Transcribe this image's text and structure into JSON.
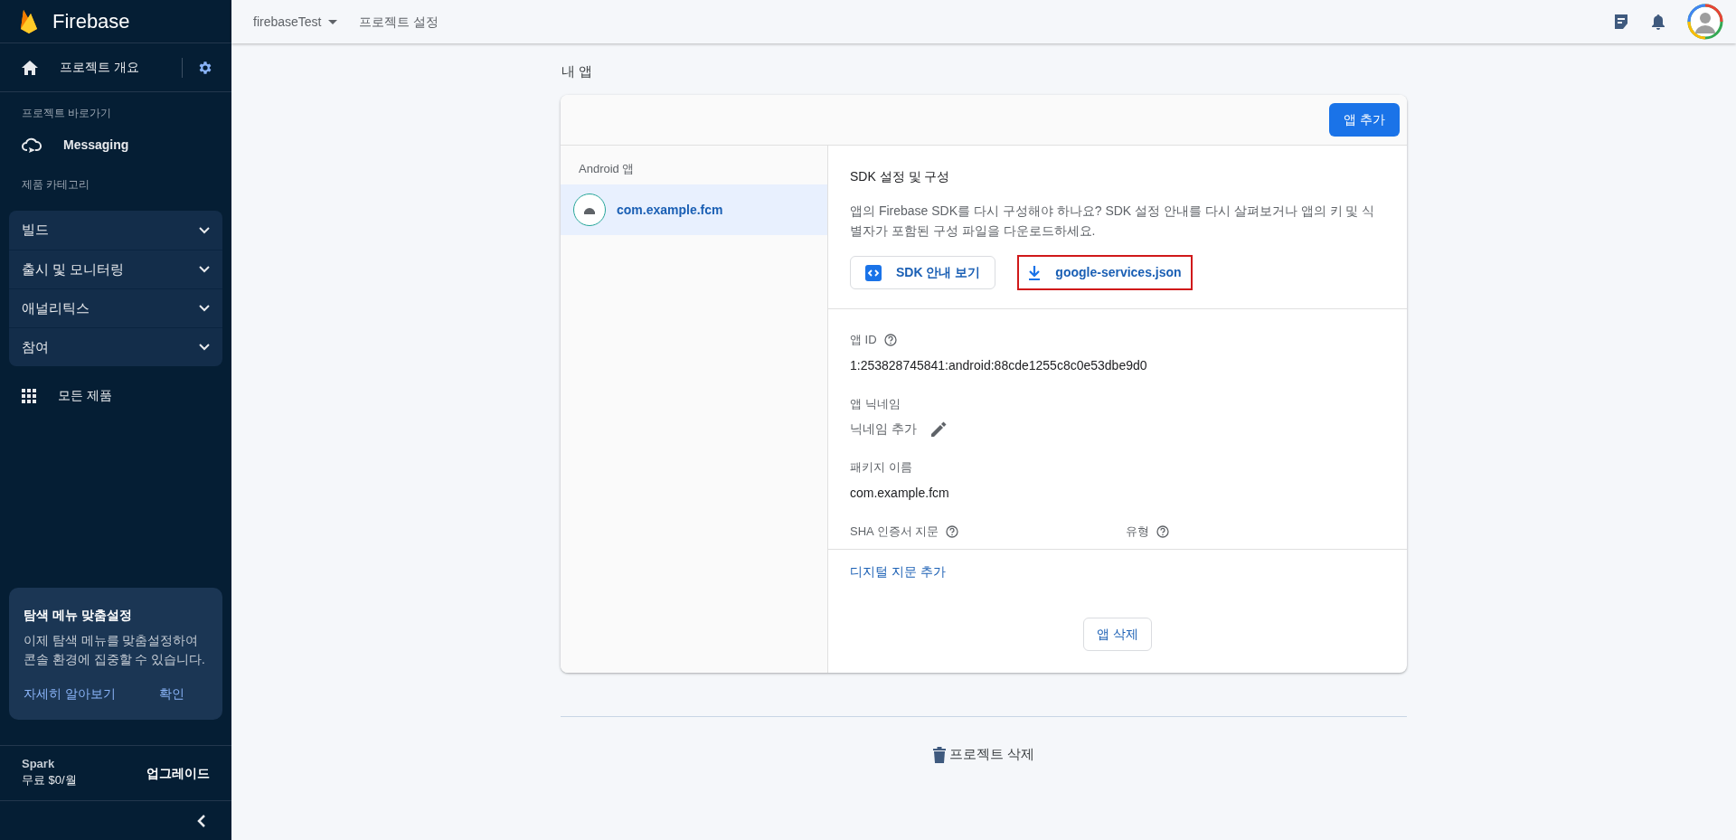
{
  "sidebar": {
    "brand": "Firebase",
    "overview": "프로젝트 개요",
    "shortcuts_heading": "프로젝트 바로가기",
    "shortcuts": [
      {
        "label": "Messaging"
      }
    ],
    "categories_heading": "제품 카테고리",
    "categories": [
      {
        "label": "빌드",
        "expanded": false
      },
      {
        "label": "출시 및 모니터링",
        "expanded": false
      },
      {
        "label": "애널리틱스",
        "expanded": false
      },
      {
        "label": "참여",
        "expanded": false
      }
    ],
    "all_products": "모든 제품",
    "tip": {
      "title": "탐색 메뉴 맞춤설정",
      "body": "이제 탐색 메뉴를 맞춤설정하여 콘솔 환경에 집중할 수 있습니다.",
      "actions": [
        "자세히 알아보기",
        "확인"
      ]
    },
    "plan": {
      "name": "Spark",
      "price": "무료 $0/월",
      "upgrade": "업그레이드"
    }
  },
  "top_bar": {
    "project": "firebaseTest",
    "page": "프로젝트 설정"
  },
  "section_title": "내 앱",
  "apps_card": {
    "add_button": "앱 추가",
    "platform_heading": "Android 앱",
    "apps": [
      {
        "name": "com.example.fcm",
        "selected": true
      }
    ],
    "sdk": {
      "title": "SDK 설정 및 구성",
      "description": "앱의 Firebase SDK를 다시 구성해야 하나요? SDK 설정 안내를 다시 살펴보거나 앱의 키 및 식별자가 포함된 구성 파일을 다운로드하세요.",
      "buttons": [
        {
          "kind": "guide",
          "label": "SDK 안내 보기",
          "highlighted": false
        },
        {
          "kind": "download",
          "label": "google-services.json",
          "highlighted": true
        }
      ]
    },
    "fields": [
      {
        "label": "앱 ID",
        "help": true,
        "editable": false,
        "value": "1:253828745841:android:88cde1255c8c0e53dbe9d0"
      },
      {
        "label": "앱 닉네임",
        "help": false,
        "editable": true,
        "value": "닉네임 추가"
      },
      {
        "label": "패키지 이름",
        "help": false,
        "editable": false,
        "value": "com.example.fcm"
      }
    ],
    "sha_columns": [
      {
        "label": "SHA 인증서 지문",
        "help": true
      },
      {
        "label": "유형",
        "help": true
      }
    ],
    "add_fingerprint": "디지털 지문 추가",
    "delete_app": "앱 삭제"
  },
  "delete_project": "프로젝트 삭제"
}
